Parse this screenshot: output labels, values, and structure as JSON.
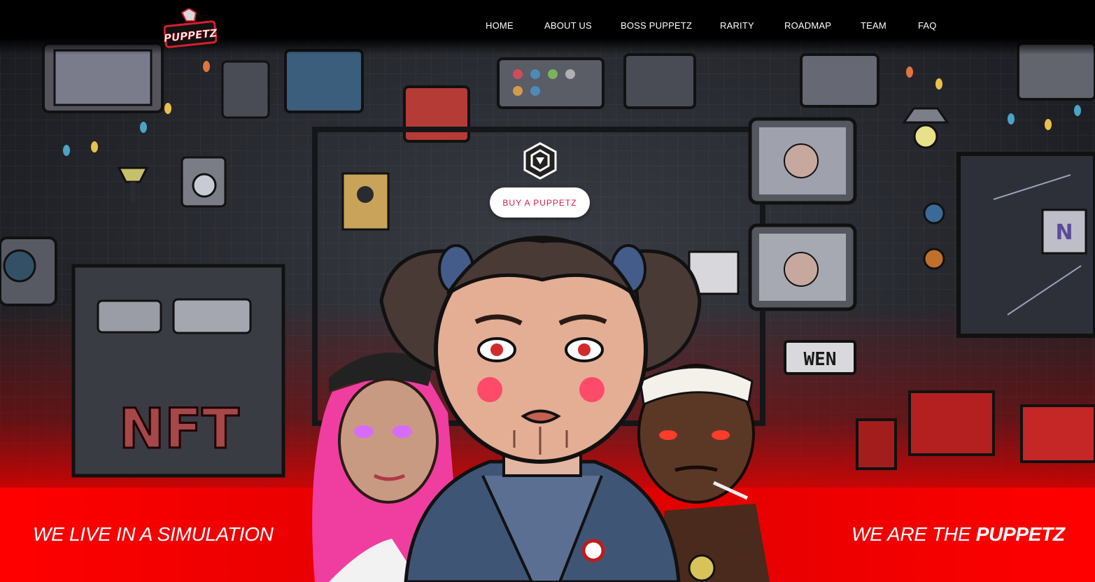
{
  "brand": {
    "logo_text": "PUPPETZ"
  },
  "nav": {
    "items": [
      {
        "label": "HOME"
      },
      {
        "label": "ABOUT US"
      },
      {
        "label": "BOSS PUPPETZ"
      },
      {
        "label": "RARITY"
      },
      {
        "label": "ROADMAP"
      },
      {
        "label": "TEAM"
      },
      {
        "label": "FAQ"
      }
    ]
  },
  "hero": {
    "badge_icon": "crypto-com-icon",
    "cta_label": "BUY A PUPPETZ",
    "wall_sign_text": "WEN",
    "wall_graffiti_text": "NFT",
    "screen_letter": "N"
  },
  "band": {
    "left_tagline": "WE LIVE IN A SIMULATION",
    "right_tagline_prefix": "WE ARE THE ",
    "right_tagline_emphasis": "PUPPETZ"
  },
  "colors": {
    "accent_red": "#ff0000",
    "cta_text": "#d6204a",
    "header_bg": "#000000"
  }
}
